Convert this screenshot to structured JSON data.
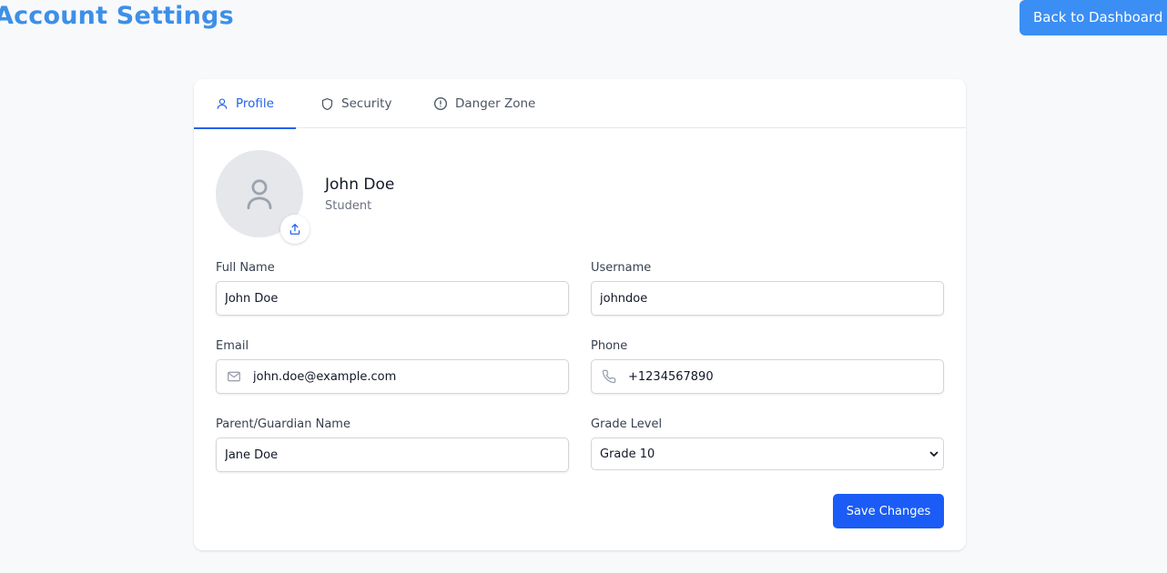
{
  "header": {
    "title": "Account Settings",
    "back_label": "Back to Dashboard"
  },
  "tabs": [
    {
      "label": "Profile",
      "icon": "user-icon",
      "active": true
    },
    {
      "label": "Security",
      "icon": "shield-icon",
      "active": false
    },
    {
      "label": "Danger Zone",
      "icon": "alert-circle-icon",
      "active": false
    }
  ],
  "profile": {
    "name": "John Doe",
    "role": "Student"
  },
  "form": {
    "full_name": {
      "label": "Full Name",
      "value": "John Doe"
    },
    "username": {
      "label": "Username",
      "value": "johndoe"
    },
    "email": {
      "label": "Email",
      "value": "john.doe@example.com"
    },
    "phone": {
      "label": "Phone",
      "value": "+1234567890"
    },
    "guardian": {
      "label": "Parent/Guardian Name",
      "value": "Jane Doe"
    },
    "grade": {
      "label": "Grade Level",
      "value": "Grade 10"
    },
    "save_label": "Save Changes"
  },
  "colors": {
    "accent": "#2563eb",
    "title": "#3d8fe8",
    "primary_button": "#1a5cf5"
  }
}
